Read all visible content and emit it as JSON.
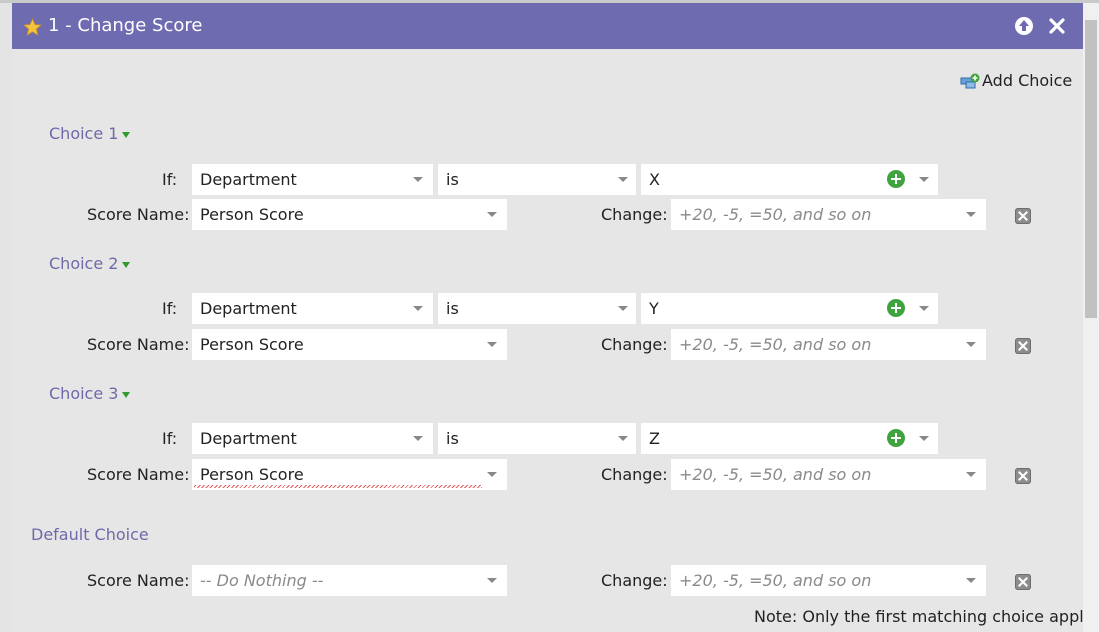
{
  "window": {
    "title": "1 - Change Score"
  },
  "toolbar": {
    "add_choice_label": "Add Choice"
  },
  "labels": {
    "if": "If:",
    "score_name": "Score Name:",
    "change": "Change:"
  },
  "choices": [
    {
      "heading": "Choice 1",
      "field": "Department",
      "operator": "is",
      "value": "X",
      "score_name": "Person Score",
      "change_placeholder": "+20, -5, =50, and so on"
    },
    {
      "heading": "Choice 2",
      "field": "Department",
      "operator": "is",
      "value": "Y",
      "score_name": "Person Score",
      "change_placeholder": "+20, -5, =50, and so on"
    },
    {
      "heading": "Choice 3",
      "field": "Department",
      "operator": "is",
      "value": "Z",
      "score_name": "Person Score",
      "change_placeholder": "+20, -5, =50, and so on"
    }
  ],
  "default_choice": {
    "heading": "Default Choice",
    "score_name_placeholder": "-- Do Nothing --",
    "change_placeholder": "+20, -5, =50, and so on"
  },
  "note": "Note: Only the first matching choice applies",
  "colors": {
    "titlebar": "#6f6bb0",
    "accent_text": "#6e6aa9",
    "panel": "#e6e6e6"
  }
}
